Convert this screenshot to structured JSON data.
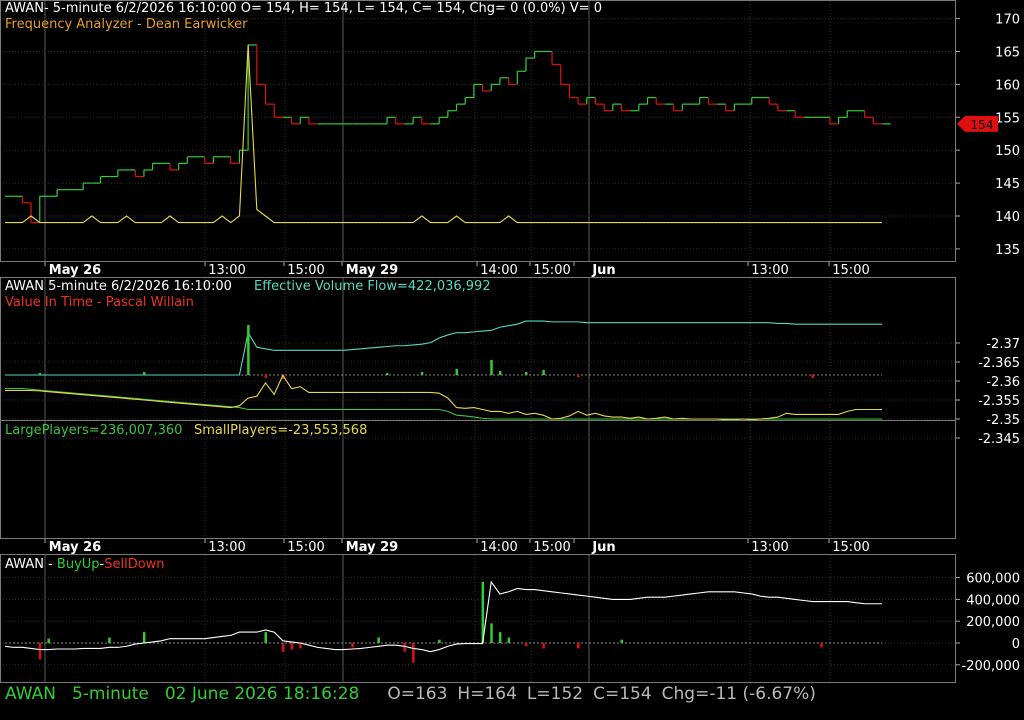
{
  "colors": {
    "price_up": "#33cc33",
    "price_down": "#dd1111",
    "yellow": "#e8d84c",
    "teal": "#58d8c0",
    "green_line": "#3ec43e",
    "white": "#ffffff",
    "label_orange": "#e8a020",
    "label_red": "#ee3322",
    "grid": "#3a3a3a",
    "status_green": "#33cc33",
    "status_gray": "#b8b8b8"
  },
  "panel1": {
    "title": "AWAN- 5-minute 6/2/2026 16:10:00 O= 154, H= 154, L= 154, C= 154, Chg= 0 (0.0%) V= 0",
    "subtitle": "Frequency Analyzer - Dean Earwicker",
    "y_ticks": [
      "170",
      "165",
      "160",
      "155",
      "150",
      "145",
      "140",
      "135"
    ],
    "last_price_badge": "154"
  },
  "panel2": {
    "title_left": "AWAN 5-minute  6/2/2026 16:10:00",
    "title_right": "Effective Volume Flow=422,036,992",
    "subtitle": "Value In Time - Pascal Willain"
  },
  "panel3": {
    "large_label": "LargePlayers=236,007,360",
    "small_label": "SmallPlayers=-23,553,568",
    "y_ticks": [
      "-2.345",
      "-2.35",
      "-2.355",
      "-2.36",
      "-2.365",
      "-2.37"
    ]
  },
  "panel4": {
    "title_main": "AWAN - ",
    "buy_label": "BuyUp",
    "sep": "-",
    "sell_label": "SellDown",
    "y_ticks": [
      "600,000",
      "400,000",
      "200,000",
      "0",
      "-200,000"
    ]
  },
  "x_axis_labels": [
    "May 26",
    "13:00",
    "15:00",
    "May 29",
    "14:00",
    "15:00",
    "Jun",
    "13:00",
    "15:00"
  ],
  "status_bar": {
    "symbol": "AWAN",
    "interval": "5-minute",
    "datetime": "02 June 2026 18:16:28",
    "open": "O=163",
    "high": "H=164",
    "low": "L=152",
    "close": "C=154",
    "change": "Chg=-11 (-6.67%)"
  },
  "chart_data": [
    {
      "type": "line",
      "title": "",
      "ylim": [
        132,
        171
      ],
      "series": [
        {
          "name": "AWAN",
          "values": [
            143,
            143,
            142,
            139,
            143,
            143,
            144,
            144,
            144,
            145,
            145,
            146,
            146,
            147,
            147,
            146,
            147,
            148,
            148,
            147,
            148,
            149,
            149,
            148,
            149,
            149,
            148,
            150,
            166,
            160,
            157,
            155,
            155,
            154,
            155,
            154,
            154,
            154,
            154,
            154,
            154,
            154,
            154,
            154,
            155,
            154,
            154,
            155,
            154,
            154,
            155,
            156,
            157,
            158,
            160,
            159,
            160,
            161,
            160,
            162,
            164,
            165,
            165,
            163,
            160,
            158,
            157,
            158,
            157,
            156,
            157,
            156,
            156,
            157,
            158,
            157,
            157,
            156,
            157,
            157,
            158,
            157,
            157,
            156,
            157,
            157,
            158,
            158,
            157,
            156,
            156,
            155,
            155,
            155,
            155,
            154,
            155,
            156,
            156,
            155,
            154,
            154
          ]
        },
        {
          "name": "Frequency Analyzer",
          "values": [
            139,
            139,
            139,
            140,
            139,
            139,
            139,
            139,
            139,
            139,
            140,
            139,
            139,
            139,
            140,
            139,
            139,
            139,
            139,
            140,
            139,
            139,
            139,
            139,
            139,
            140,
            139,
            140,
            166,
            141,
            140,
            139,
            139,
            139,
            139,
            139,
            139,
            139,
            139,
            139,
            139,
            139,
            139,
            139,
            139,
            139,
            139,
            139,
            140,
            139,
            139,
            139,
            140,
            139,
            139,
            139,
            139,
            139,
            140,
            139,
            139,
            139,
            139,
            139,
            139,
            139,
            139,
            139,
            139,
            139,
            139,
            139,
            139,
            139,
            139,
            139,
            139,
            139,
            139,
            139,
            139,
            139,
            139,
            139,
            139,
            139,
            139,
            139,
            139,
            139,
            139,
            139,
            139,
            139,
            139,
            139,
            139,
            139,
            139,
            139,
            139,
            139
          ]
        }
      ]
    },
    {
      "type": "line",
      "title": "Effective Volume Flow",
      "series": [
        {
          "name": "Effective Volume Flow",
          "values": [
            0,
            0,
            0,
            0,
            0,
            0,
            0,
            0,
            0,
            0,
            0,
            0,
            0,
            0,
            0,
            0,
            0,
            0,
            0,
            0,
            0,
            0,
            0,
            0,
            0,
            0,
            0,
            0,
            55,
            36,
            34,
            32,
            32,
            32,
            32,
            32,
            32,
            32,
            32,
            32,
            33,
            34,
            35,
            36,
            37,
            38,
            38,
            39,
            40,
            42,
            48,
            52,
            55,
            55,
            56,
            57,
            58,
            62,
            64,
            66,
            70,
            70,
            70,
            69,
            69,
            69,
            69,
            68,
            68,
            68,
            68,
            68,
            68,
            68,
            68,
            68,
            68,
            68,
            68,
            68,
            68,
            68,
            68,
            68,
            68,
            68,
            68,
            68,
            68,
            67,
            67,
            66,
            66,
            66,
            66,
            66,
            66,
            66,
            66,
            66,
            66,
            66
          ]
        }
      ]
    },
    {
      "type": "line",
      "title": "",
      "ylim": [
        -2.37,
        -2.345
      ],
      "series": [
        {
          "name": "LargePlayers",
          "values": [
            -2.358,
            -2.358,
            -2.358,
            -2.3578,
            -2.3576,
            -2.3574,
            -2.3572,
            -2.357,
            -2.3568,
            -2.3566,
            -2.3564,
            -2.3562,
            -2.356,
            -2.3558,
            -2.3556,
            -2.3554,
            -2.3552,
            -2.355,
            -2.3548,
            -2.3546,
            -2.3544,
            -2.3542,
            -2.354,
            -2.3538,
            -2.3536,
            -2.3534,
            -2.3532,
            -2.353,
            -2.3525,
            -2.3525,
            -2.3525,
            -2.3525,
            -2.3525,
            -2.3525,
            -2.3525,
            -2.3525,
            -2.3525,
            -2.3525,
            -2.3525,
            -2.3525,
            -2.3525,
            -2.3525,
            -2.3525,
            -2.3525,
            -2.3525,
            -2.3525,
            -2.3525,
            -2.3525,
            -2.3525,
            -2.3525,
            -2.3525,
            -2.352,
            -2.351,
            -2.3508,
            -2.3505,
            -2.3502,
            -2.35,
            -2.35,
            -2.35,
            -2.35,
            -2.35,
            -2.35,
            -2.35,
            -2.35,
            -2.35,
            -2.35,
            -2.35,
            -2.35,
            -2.35,
            -2.35,
            -2.35,
            -2.35,
            -2.35,
            -2.35,
            -2.35,
            -2.35,
            -2.35,
            -2.35,
            -2.35,
            -2.35,
            -2.35,
            -2.35,
            -2.35,
            -2.35,
            -2.35,
            -2.35,
            -2.35,
            -2.35,
            -2.35,
            -2.35,
            -2.35,
            -2.35,
            -2.35,
            -2.35,
            -2.35,
            -2.35,
            -2.35,
            -2.35,
            -2.35,
            -2.35,
            -2.35,
            -2.35
          ]
        },
        {
          "name": "SmallPlayers",
          "values": [
            -2.3575,
            -2.3575,
            -2.3575,
            -2.3575,
            -2.3574,
            -2.3572,
            -2.357,
            -2.3568,
            -2.3566,
            -2.3564,
            -2.3562,
            -2.356,
            -2.3558,
            -2.3556,
            -2.3554,
            -2.3552,
            -2.355,
            -2.3548,
            -2.3546,
            -2.3544,
            -2.3542,
            -2.354,
            -2.3538,
            -2.3536,
            -2.3534,
            -2.3532,
            -2.353,
            -2.3535,
            -2.3555,
            -2.356,
            -2.3595,
            -2.3565,
            -2.3615,
            -2.358,
            -2.3585,
            -2.357,
            -2.357,
            -2.357,
            -2.357,
            -2.357,
            -2.357,
            -2.357,
            -2.357,
            -2.357,
            -2.357,
            -2.357,
            -2.357,
            -2.357,
            -2.357,
            -2.357,
            -2.3568,
            -2.3555,
            -2.353,
            -2.3528,
            -2.353,
            -2.3525,
            -2.352,
            -2.352,
            -2.3515,
            -2.352,
            -2.3512,
            -2.3515,
            -2.351,
            -2.35,
            -2.3502,
            -2.3508,
            -2.352,
            -2.351,
            -2.3515,
            -2.3508,
            -2.3505,
            -2.3505,
            -2.3502,
            -2.3505,
            -2.35,
            -2.3502,
            -2.3505,
            -2.35,
            -2.3502,
            -2.35,
            -2.35,
            -2.35,
            -2.35,
            -2.3498,
            -2.3498,
            -2.35,
            -2.3498,
            -2.35,
            -2.3502,
            -2.3505,
            -2.3515,
            -2.3512,
            -2.3512,
            -2.3512,
            -2.3512,
            -2.3512,
            -2.3512,
            -2.352,
            -2.3525,
            -2.3525,
            -2.3525,
            -2.3525
          ]
        }
      ]
    },
    {
      "type": "line",
      "title": "",
      "ylim": [
        -280000,
        680000
      ],
      "series": [
        {
          "name": "BuyUp-SellDown",
          "values": [
            -30000,
            -40000,
            -40000,
            -50000,
            -60000,
            -60000,
            -55000,
            -55000,
            -55000,
            -50000,
            -50000,
            -50000,
            -40000,
            -40000,
            -30000,
            -10000,
            0,
            10000,
            20000,
            40000,
            40000,
            40000,
            40000,
            40000,
            50000,
            60000,
            70000,
            100000,
            100000,
            100000,
            120000,
            100000,
            20000,
            10000,
            0,
            -20000,
            -40000,
            -50000,
            -60000,
            -60000,
            -55000,
            -50000,
            -40000,
            -30000,
            -20000,
            -20000,
            -30000,
            -50000,
            -60000,
            -80000,
            -60000,
            -30000,
            -10000,
            -5000,
            -5000,
            -5000,
            560000,
            450000,
            470000,
            500000,
            490000,
            490000,
            480000,
            470000,
            460000,
            450000,
            440000,
            430000,
            420000,
            410000,
            400000,
            400000,
            400000,
            410000,
            420000,
            420000,
            420000,
            430000,
            440000,
            450000,
            460000,
            470000,
            470000,
            470000,
            470000,
            460000,
            450000,
            430000,
            420000,
            420000,
            410000,
            400000,
            390000,
            380000,
            380000,
            380000,
            380000,
            380000,
            370000,
            360000,
            360000,
            360000
          ]
        }
      ]
    }
  ]
}
